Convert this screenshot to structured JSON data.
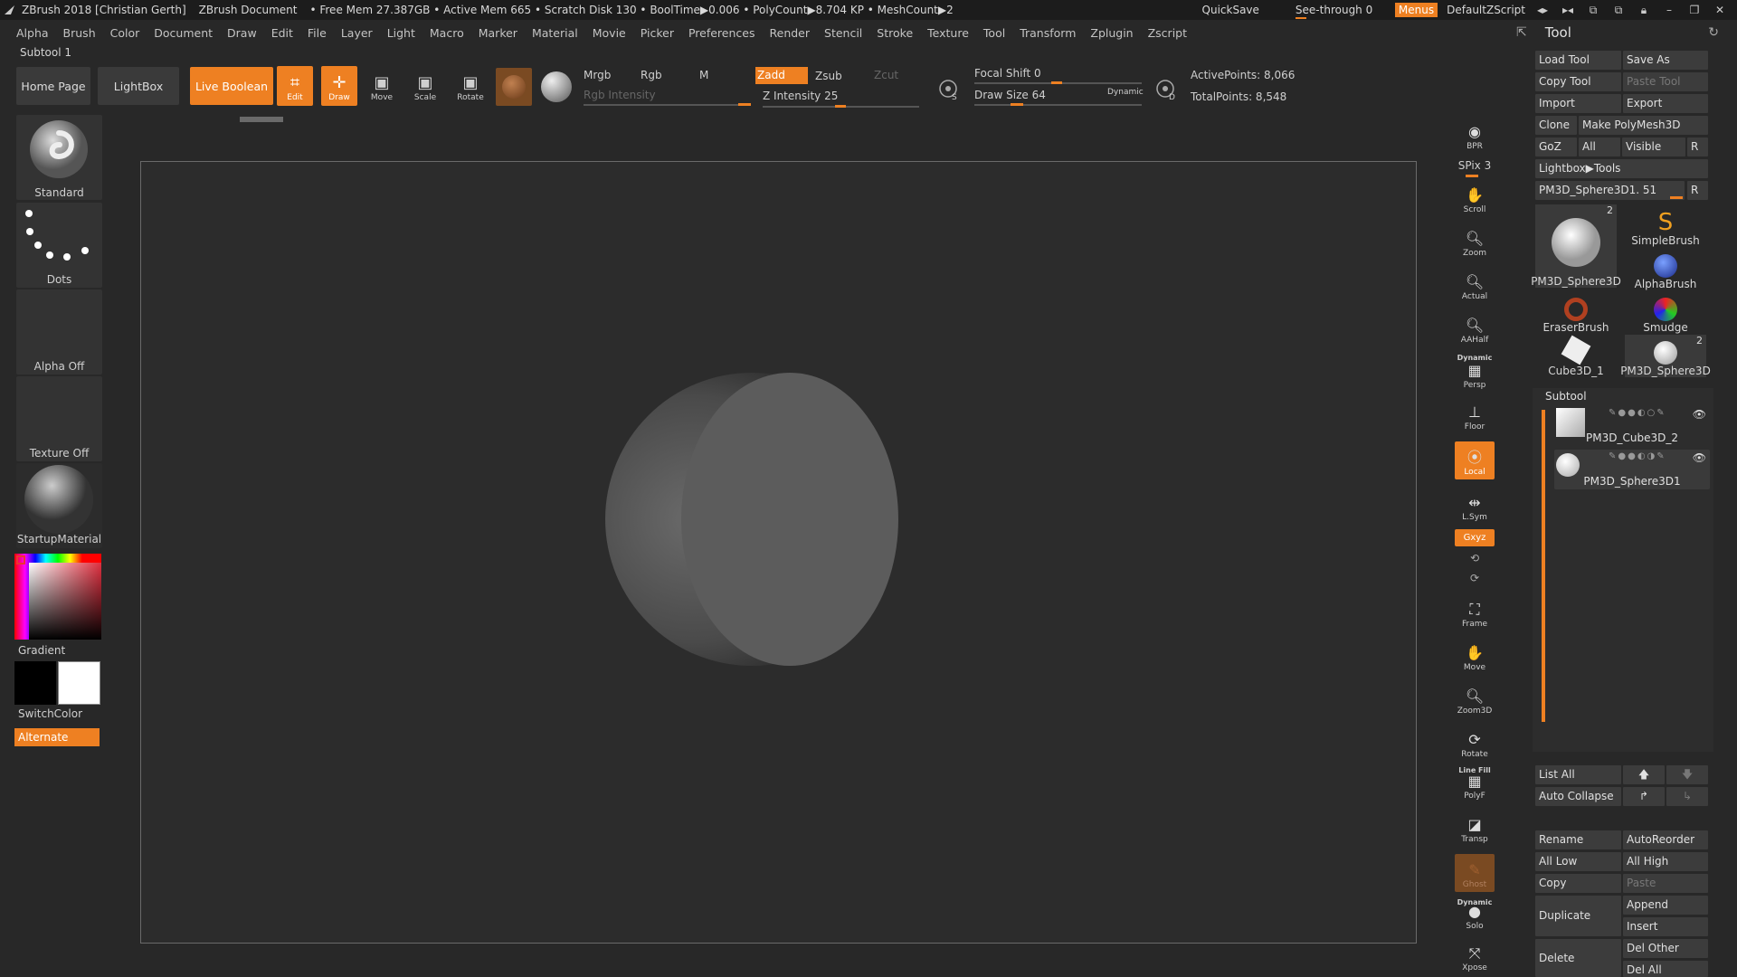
{
  "titlebar": {
    "app": "ZBrush 2018 [Christian Gerth]",
    "document": "ZBrush Document",
    "stats": "• Free Mem 27.387GB • Active Mem 665 • Scratch Disk 130 • BoolTime▶0.006 • PolyCount▶8.704 KP • MeshCount▶2",
    "quicksave": "QuickSave",
    "seethrough": "See-through  0",
    "menus": "Menus",
    "defaultzscript": "DefaultZScript"
  },
  "menubar": [
    "Alpha",
    "Brush",
    "Color",
    "Document",
    "Draw",
    "Edit",
    "File",
    "Layer",
    "Light",
    "Macro",
    "Marker",
    "Material",
    "Movie",
    "Picker",
    "Preferences",
    "Render",
    "Stencil",
    "Stroke",
    "Texture",
    "Tool",
    "Transform",
    "Zplugin",
    "Zscript"
  ],
  "tool_header": "Tool",
  "subtool_label": "Subtool 1",
  "shelf": {
    "home_page": "Home Page",
    "lightbox": "LightBox",
    "live_boolean": "Live Boolean",
    "edit": "Edit",
    "draw": "Draw",
    "move": "Move",
    "scale": "Scale",
    "rotate": "Rotate",
    "mrgb": "Mrgb",
    "rgb": "Rgb",
    "m": "M",
    "zadd": "Zadd",
    "zsub": "Zsub",
    "zcut": "Zcut",
    "rgb_intensity": "Rgb Intensity",
    "z_intensity": "Z Intensity 25",
    "focal_shift": "Focal Shift 0",
    "draw_size": "Draw Size 64",
    "dynamic": "Dynamic",
    "active_points": "ActivePoints: 8,066",
    "total_points": "TotalPoints: 8,548"
  },
  "left_panel": {
    "brush": "Standard",
    "stroke": "Dots",
    "alpha": "Alpha Off",
    "texture": "Texture Off",
    "material": "StartupMaterial",
    "gradient": "Gradient",
    "switchcolor": "SwitchColor",
    "alternate": "Alternate"
  },
  "right_strip": {
    "bpr": "BPR",
    "spix": "SPix 3",
    "scroll": "Scroll",
    "zoom": "Zoom",
    "actual": "Actual",
    "aahalf": "AAHalf",
    "dynamic_label": "Dynamic",
    "persp": "Persp",
    "floor": "Floor",
    "local": "Local",
    "lsym": "L.Sym",
    "xyz": "Gxyz",
    "frame": "Frame",
    "move": "Move",
    "zoom3d": "Zoom3D",
    "rotate": "Rotate",
    "line_fill": "Line Fill",
    "polyf": "PolyF",
    "transp": "Transp",
    "ghost": "Ghost",
    "dynamic2": "Dynamic",
    "solo": "Solo",
    "xpose": "Xpose"
  },
  "tool_panel": {
    "load_tool": "Load Tool",
    "save_as": "Save As",
    "copy_tool": "Copy Tool",
    "paste_tool": "Paste Tool",
    "import": "Import",
    "export": "Export",
    "clone": "Clone",
    "make_polymesh": "Make PolyMesh3D",
    "goz": "GoZ",
    "all": "All",
    "visible": "Visible",
    "r": "R",
    "lightbox_tools": "Lightbox▶Tools",
    "current_tool": "PM3D_Sphere3D1. 51",
    "r2": "R",
    "brushes": [
      {
        "name": "PM3D_Sphere3D",
        "count": "2"
      },
      {
        "name": "SimpleBrush",
        "count": ""
      },
      {
        "name": "AlphaBrush",
        "count": ""
      },
      {
        "name": "EraserBrush",
        "count": ""
      },
      {
        "name": "Smudge",
        "count": ""
      },
      {
        "name": "Cube3D_1",
        "count": ""
      },
      {
        "name": "PM3D_Sphere3D",
        "count": "2"
      }
    ]
  },
  "subtool_panel": {
    "title": "Subtool",
    "items": [
      {
        "name": "PM3D_Cube3D_2"
      },
      {
        "name": "PM3D_Sphere3D1"
      }
    ],
    "list_all": "List All",
    "auto_collapse": "Auto Collapse",
    "rename": "Rename",
    "autoreorder": "AutoReorder",
    "all_low": "All Low",
    "all_high": "All High",
    "copy": "Copy",
    "paste": "Paste",
    "duplicate": "Duplicate",
    "append": "Append",
    "insert": "Insert",
    "delete": "Delete",
    "del_other": "Del Other",
    "del_all": "Del All"
  },
  "colors": {
    "accent": "#ee8022",
    "background": "#282828",
    "canvas": "#2c2c2c"
  }
}
